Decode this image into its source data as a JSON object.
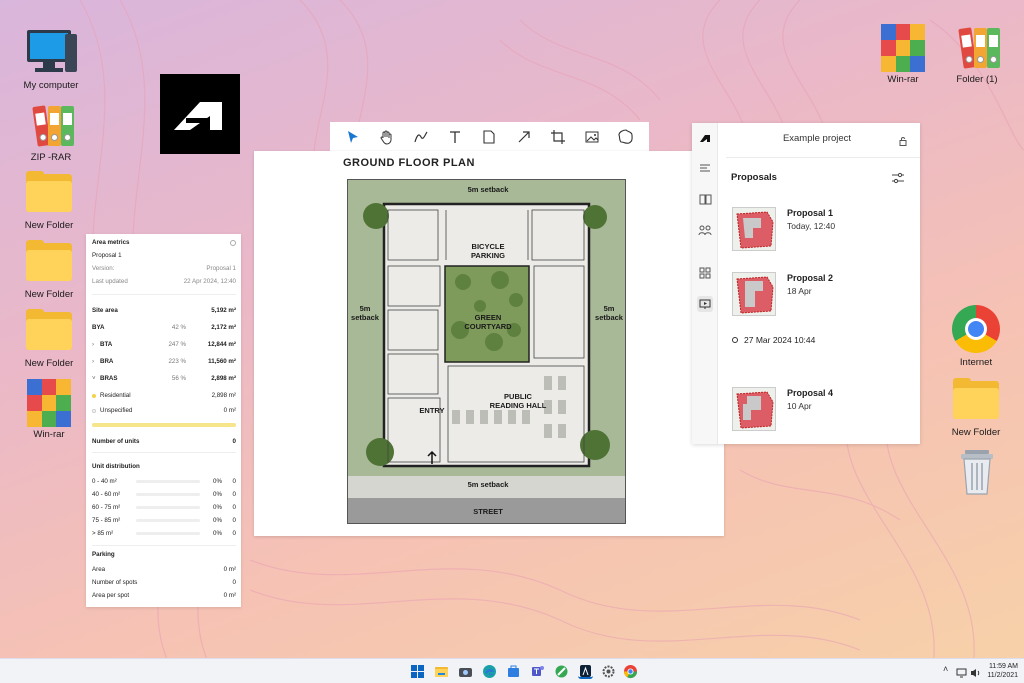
{
  "desktop": {
    "icons": [
      {
        "label": "My computer"
      },
      {
        "label": "ZIP -RAR"
      },
      {
        "label": "New Folder"
      },
      {
        "label": "New Folder"
      },
      {
        "label": "New Folder"
      },
      {
        "label": "Win-rar"
      },
      {
        "label": "Win-rar"
      },
      {
        "label": "Folder (1)"
      },
      {
        "label": "Internet"
      },
      {
        "label": "New Folder"
      }
    ]
  },
  "canvas": {
    "title": "GROUND FLOOR PLAN",
    "labels": {
      "setback_top": "5m setback",
      "setback_left": "5m\nsetback",
      "setback_right": "5m\nsetback",
      "setback_bottom": "5m setback",
      "bicycle": "BICYCLE\nPARKING",
      "courtyard": "GREEN\nCOURTYARD",
      "reading": "PUBLIC\nREADING HALL",
      "entry": "ENTRY",
      "street": "STREET"
    }
  },
  "metrics": {
    "header": "Area metrics",
    "proposal": "Proposal 1",
    "version_label": "Version:",
    "version_value": "Proposal 1",
    "updated_label": "Last updated",
    "updated_value": "22 Apr 2024, 12:40",
    "rows": [
      {
        "key": "Site area",
        "pct": "",
        "val": "5,192 m²"
      },
      {
        "key": "BYA",
        "pct": "42 %",
        "val": "2,172 m²"
      },
      {
        "key": "BTA",
        "pct": "247 %",
        "val": "12,844 m²"
      },
      {
        "key": "BRA",
        "pct": "223 %",
        "val": "11,560 m²"
      },
      {
        "key": "BRAS",
        "pct": "56 %",
        "val": "2,898 m²"
      },
      {
        "key": "Residential",
        "pct": "",
        "val": "2,898 m²"
      },
      {
        "key": "Unspecified",
        "pct": "",
        "val": "0 m²"
      }
    ],
    "units_label": "Number of units",
    "units_value": "0",
    "distribution_header": "Unit distribution",
    "distribution": [
      {
        "range": "0 - 40 m²",
        "pct": "0%",
        "count": "0"
      },
      {
        "range": "40 - 60 m²",
        "pct": "0%",
        "count": "0"
      },
      {
        "range": "60 - 75 m²",
        "pct": "0%",
        "count": "0"
      },
      {
        "range": "75 - 85 m²",
        "pct": "0%",
        "count": "0"
      },
      {
        "range": "> 85 m²",
        "pct": "0%",
        "count": "0"
      }
    ],
    "parking_header": "Parking",
    "parking": [
      {
        "key": "Area",
        "val": "0 m²"
      },
      {
        "key": "Number of spots",
        "val": "0"
      },
      {
        "key": "Area per spot",
        "val": "0 m²"
      }
    ]
  },
  "project": {
    "title": "Example project",
    "proposals_header": "Proposals",
    "proposals": [
      {
        "name": "Proposal 1",
        "date": "Today, 12:40"
      },
      {
        "name": "Proposal 2",
        "date": "18 Apr"
      },
      {
        "name": "Proposal 4",
        "date": "10 Apr"
      }
    ],
    "timeline_entry": "27 Mar 2024 10:44"
  },
  "taskbar": {
    "time": "11:59 AM",
    "date": "11/2/2021"
  },
  "colors": {
    "accent_blue": "#0a66c2",
    "proposal_red": "#d9434f",
    "folder_yellow": "#ffd35a"
  }
}
